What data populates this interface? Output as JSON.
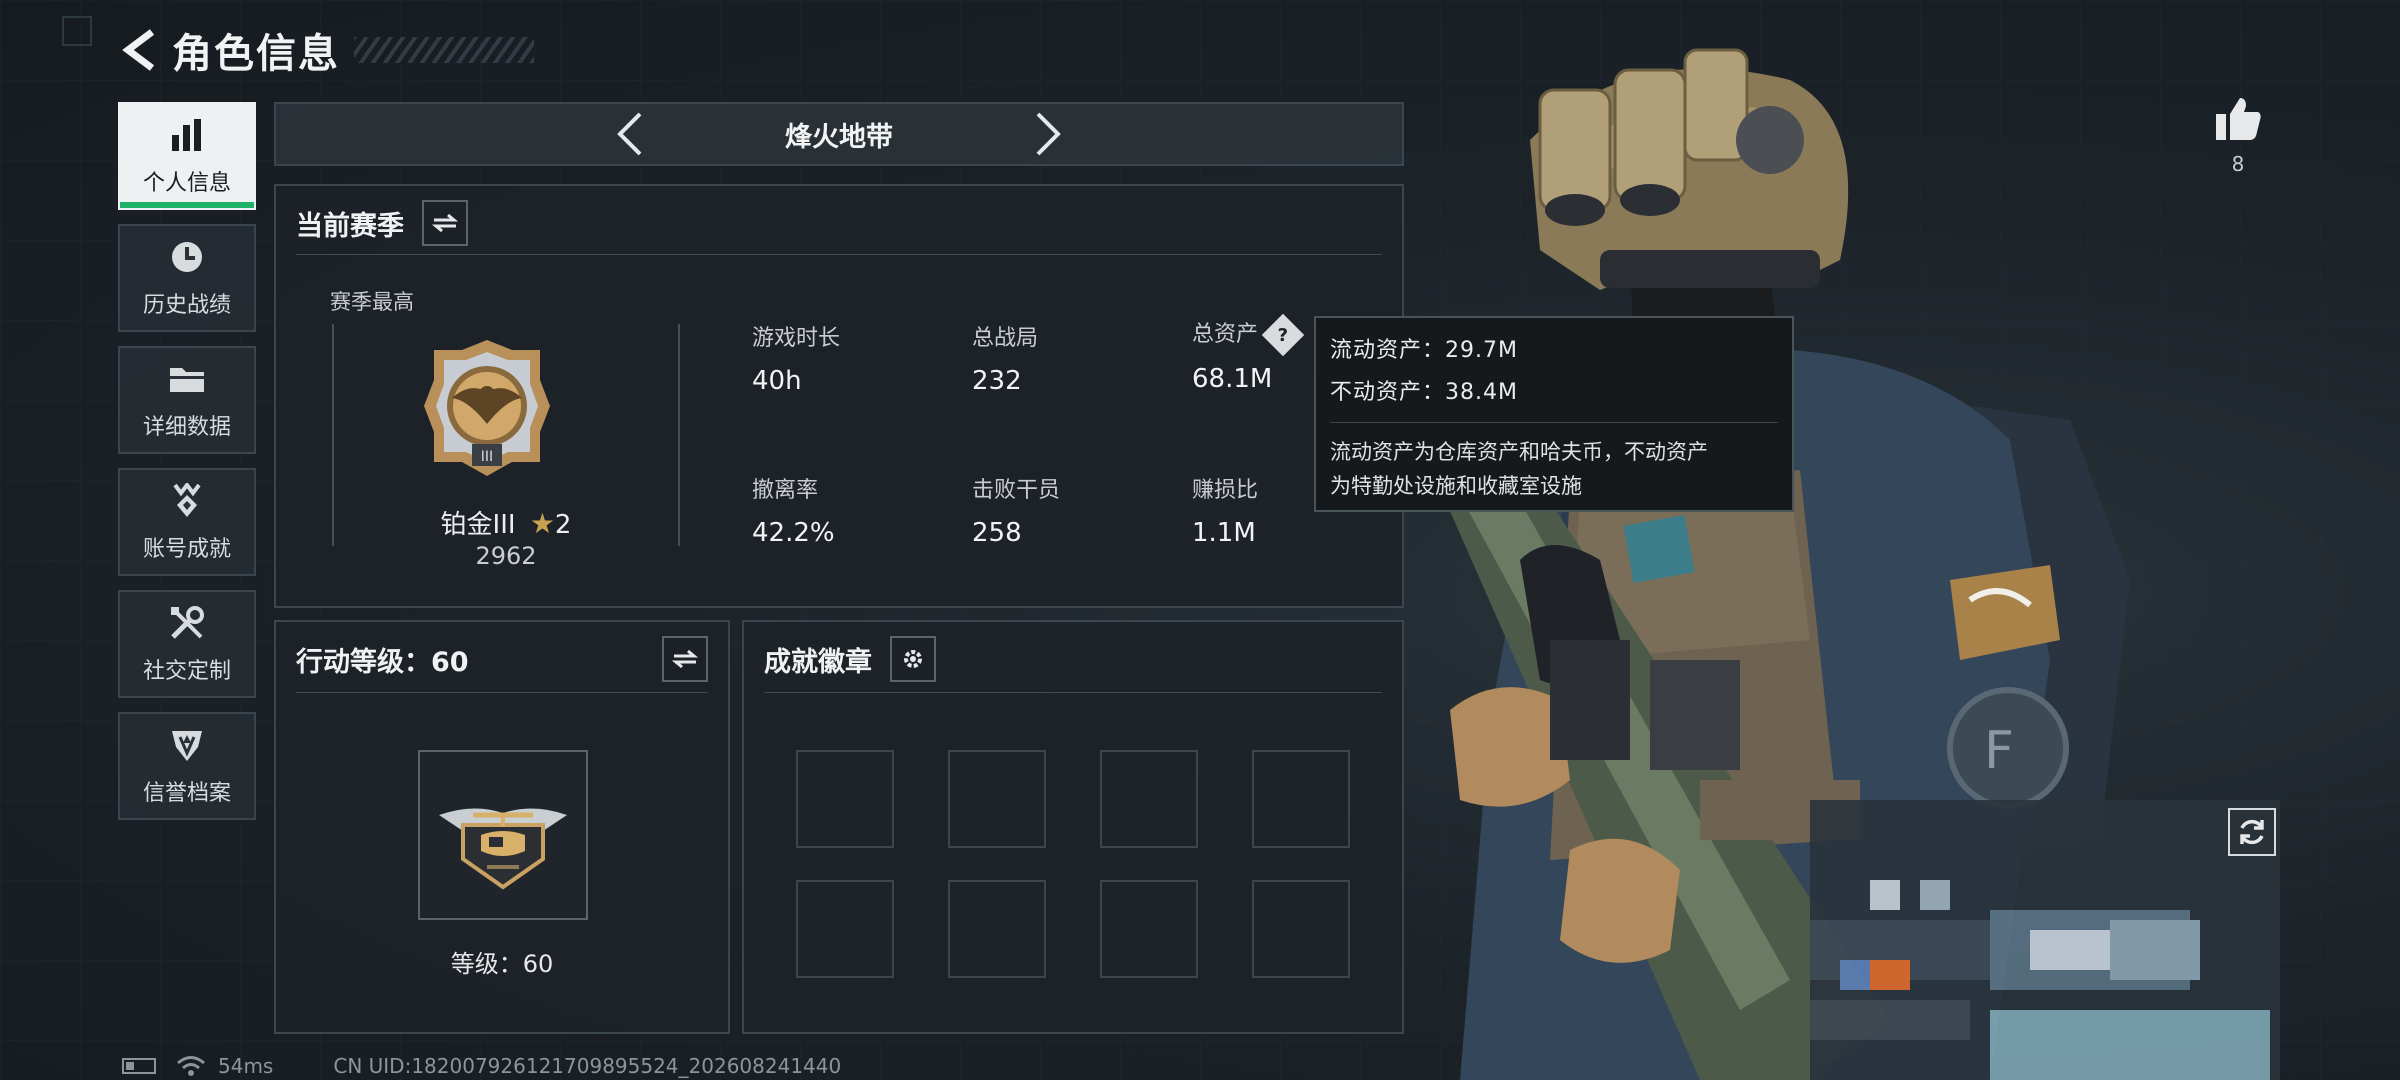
{
  "header": {
    "title": "角色信息"
  },
  "nav": {
    "items": [
      {
        "label": "个人信息",
        "icon": "bar-chart-icon",
        "active": true
      },
      {
        "label": "历史战绩",
        "icon": "clock-icon",
        "active": false
      },
      {
        "label": "详细数据",
        "icon": "folder-icon",
        "active": false
      },
      {
        "label": "账号成就",
        "icon": "medal-icon",
        "active": false
      },
      {
        "label": "社交定制",
        "icon": "tools-icon",
        "active": false
      },
      {
        "label": "信誉档案",
        "icon": "shield-icon",
        "active": false
      }
    ]
  },
  "mode": {
    "name": "烽火地带"
  },
  "season": {
    "title": "当前赛季",
    "subtitle": "赛季最高",
    "rank_name": "铂金III",
    "rank_stars": "2",
    "rank_score": "2962",
    "stats": [
      {
        "label": "游戏时长",
        "value": "40h"
      },
      {
        "label": "总战局",
        "value": "232"
      },
      {
        "label": "总资产",
        "value": "68.1M"
      },
      {
        "label": "撤离率",
        "value": "42.2%"
      },
      {
        "label": "击败干员",
        "value": "258"
      },
      {
        "label": "赚损比",
        "value": "1.1M"
      }
    ]
  },
  "tooltip": {
    "liquid": "流动资产：29.7M",
    "fixed": "不动资产：38.4M",
    "desc_line1": "流动资产为仓库资产和哈夫币，不动资产",
    "desc_line2": "为特勤处设施和收藏室设施"
  },
  "action_level": {
    "title": "行动等级：60",
    "level_text": "等级：60"
  },
  "achievements": {
    "title": "成就徽章"
  },
  "likes": {
    "count": "8"
  },
  "status_bar": {
    "ping": "54ms",
    "uid": "CN UID:182007926121709895524_202608241440"
  },
  "colors": {
    "accent_green": "#1fb36a",
    "panel_bg": "#1c2228",
    "border": "#3b464e",
    "text": "#e6e8ea"
  }
}
